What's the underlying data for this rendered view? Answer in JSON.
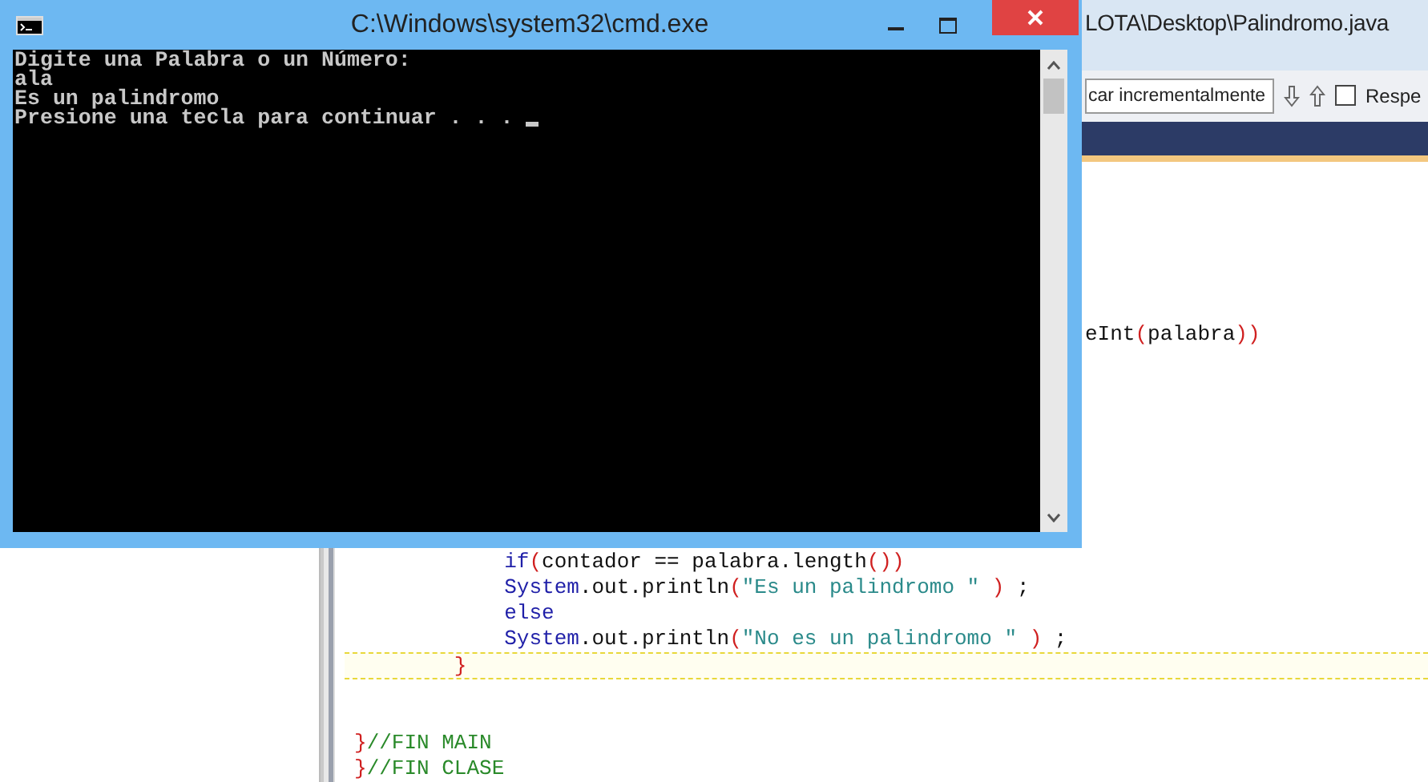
{
  "ide_window": {
    "title": "LOTA\\Desktop\\Palindromo.java",
    "search": {
      "value": "car incrementalmente"
    },
    "toolbar": [
      {
        "kind": "down"
      },
      {
        "kind": "up"
      }
    ],
    "match_case": {
      "label": "Respe",
      "checked": false
    },
    "code_blocks": [
      {
        "lines": [
          {
            "current": false,
            "tokens": [
              {
                "text": "eInt",
                "kind": "plain"
              },
              {
                "text": "(",
                "kind": "paren"
              },
              {
                "text": "palabra",
                "kind": "plain"
              },
              {
                "text": "))",
                "kind": "paren"
              }
            ]
          }
        ]
      },
      {
        "lines": [
          {
            "current": false,
            "tokens": [
              {
                "text": "            if",
                "kind": "keyword"
              },
              {
                "text": "(",
                "kind": "paren"
              },
              {
                "text": "contador == palabra.length",
                "kind": "plain"
              },
              {
                "text": "())",
                "kind": "paren"
              }
            ]
          },
          {
            "current": false,
            "tokens": [
              {
                "text": "            System",
                "kind": "keyword"
              },
              {
                "text": ".out.println",
                "kind": "plain"
              },
              {
                "text": "(",
                "kind": "paren"
              },
              {
                "text": "\"Es un palindromo \"",
                "kind": "string"
              },
              {
                "text": " )",
                "kind": "paren"
              },
              {
                "text": " ;",
                "kind": "plain"
              }
            ]
          },
          {
            "current": false,
            "tokens": [
              {
                "text": "            else",
                "kind": "keyword"
              }
            ]
          },
          {
            "current": false,
            "tokens": [
              {
                "text": "            System",
                "kind": "keyword"
              },
              {
                "text": ".out.println",
                "kind": "plain"
              },
              {
                "text": "(",
                "kind": "paren"
              },
              {
                "text": "\"No es un palindromo \"",
                "kind": "string"
              },
              {
                "text": " )",
                "kind": "paren"
              },
              {
                "text": " ;",
                "kind": "plain"
              }
            ]
          },
          {
            "current": true,
            "tokens": [
              {
                "text": "        }",
                "kind": "paren"
              }
            ]
          },
          {
            "current": false
          },
          {
            "current": false
          },
          {
            "current": false,
            "tokens": [
              {
                "text": "}",
                "kind": "paren"
              },
              {
                "text": "//FIN MAIN",
                "kind": "comment"
              }
            ]
          },
          {
            "current": false,
            "tokens": [
              {
                "text": "}",
                "kind": "paren"
              },
              {
                "text": "//FIN CLASE",
                "kind": "comment"
              }
            ]
          }
        ]
      }
    ]
  },
  "cmd_window": {
    "title": "C:\\Windows\\system32\\cmd.exe",
    "output": [
      "Digite una Palabra o un Número:",
      "ala",
      "Es un palindromo",
      "Presione una tecla para continuar . . ."
    ]
  }
}
